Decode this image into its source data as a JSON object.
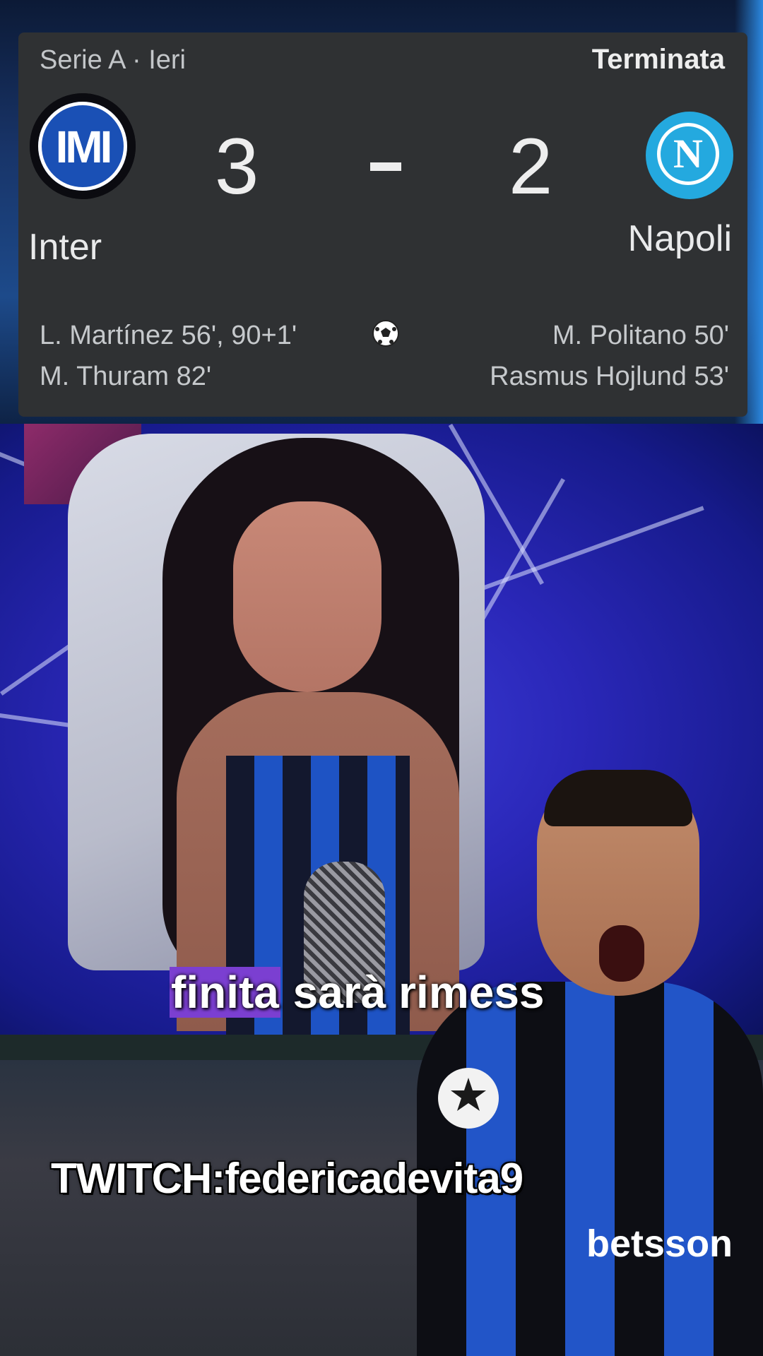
{
  "match": {
    "league_label": "Serie A · Ieri",
    "status": "Terminata",
    "home_team": "Inter",
    "away_team": "Napoli",
    "home_score": "3",
    "away_score": "2",
    "home_scorers": [
      "L. Martínez 56', 90+1'",
      "M. Thuram 82'"
    ],
    "away_scorers": [
      "M. Politano 50'",
      "Rasmus Hojlund 53'"
    ],
    "napoli_logo_letter": "N"
  },
  "overlay": {
    "caption_highlight": "finita",
    "caption_rest": " sarà rimess",
    "watermark": "TWITCH:federicadevita9",
    "sponsor_text": "betsson"
  },
  "colors": {
    "card_bg": "#2f3133",
    "inter_blue": "#1a50b5",
    "napoli_blue": "#24a9df",
    "caption_highlight": "#7b3fd1"
  }
}
